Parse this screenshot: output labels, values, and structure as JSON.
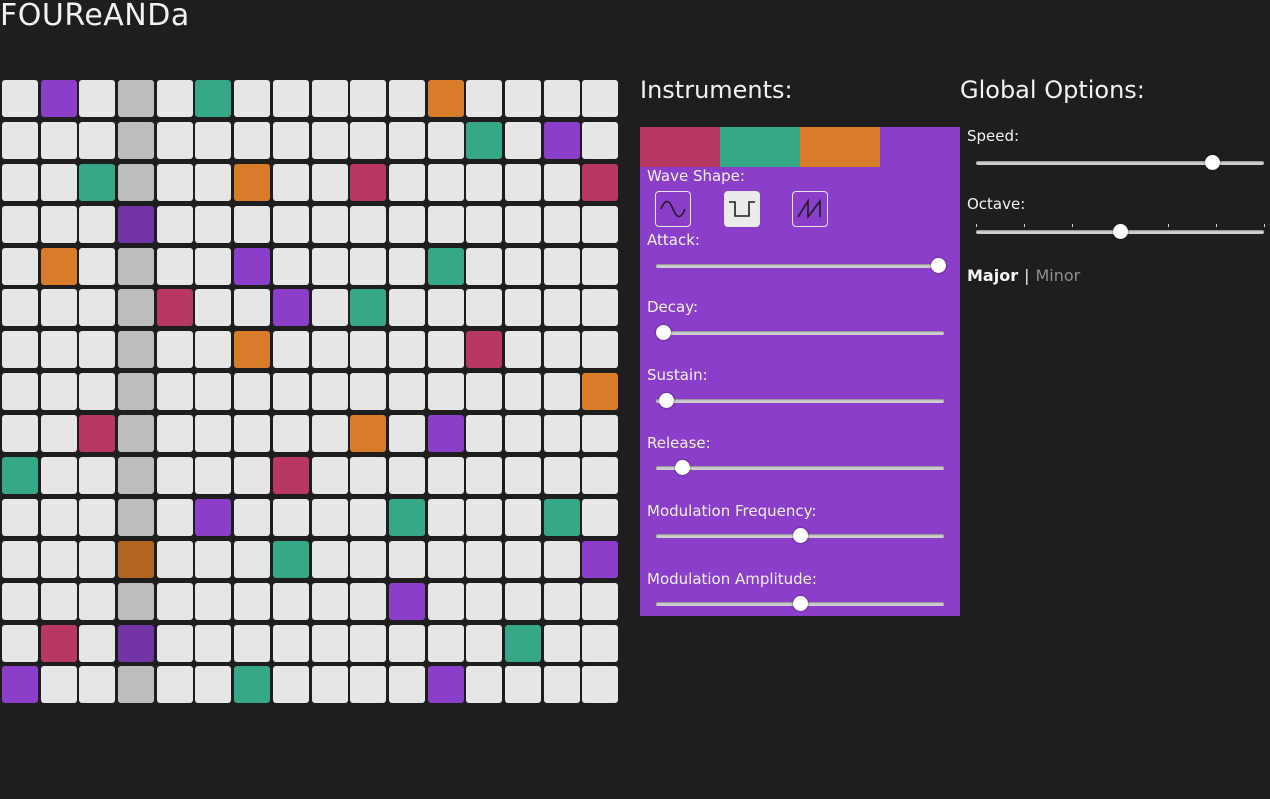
{
  "app": {
    "title": "FOUReANDa"
  },
  "colors": {
    "cell_empty": "#e6e6e6",
    "cell_current_column": "#bdbdbd",
    "instrument_1": "#b83862",
    "instrument_2": "#36a887",
    "instrument_3": "#d97c2a",
    "instrument_4": "#8a3ec9"
  },
  "sequencer": {
    "columns": 16,
    "rows": 15,
    "current_column": 3,
    "rows_data": [
      "0400020000030000",
      "0000000000002040",
      "0020003001000001",
      "0004000000000000",
      "0300004000020000",
      "0000100402000000",
      "0000003000001000",
      "0000000000000003",
      "0010000003040000",
      "2000000100000000",
      "0000040000200020",
      "0003000200000004",
      "0000000000400000",
      "0104000000000200",
      "4000002000040000"
    ]
  },
  "instruments": {
    "heading": "Instruments:",
    "tabs": [
      {
        "color": "#b83862"
      },
      {
        "color": "#36a887"
      },
      {
        "color": "#d97c2a"
      },
      {
        "color": "#8a3ec9"
      }
    ],
    "selected_tab": 3,
    "wave_shape": {
      "label": "Wave Shape:",
      "options": [
        "sine-wave-icon",
        "square-wave-icon",
        "sawtooth-wave-icon"
      ],
      "selected": 1
    },
    "sliders": [
      {
        "label": "Attack:",
        "value": 0.98
      },
      {
        "label": "Decay:",
        "value": 0.025
      },
      {
        "label": "Sustain:",
        "value": 0.035
      },
      {
        "label": "Release:",
        "value": 0.09
      },
      {
        "label": "Modulation Frequency:",
        "value": 0.5
      },
      {
        "label": "Modulation Amplitude:",
        "value": 0.5
      }
    ]
  },
  "global_options": {
    "heading": "Global Options:",
    "speed": {
      "label": "Speed:",
      "value": 0.82
    },
    "octave": {
      "label": "Octave:",
      "value": 0.5,
      "steps": 7
    },
    "scale": {
      "options": [
        "Major",
        "Minor"
      ],
      "separator": "|",
      "selected": "Major"
    }
  }
}
